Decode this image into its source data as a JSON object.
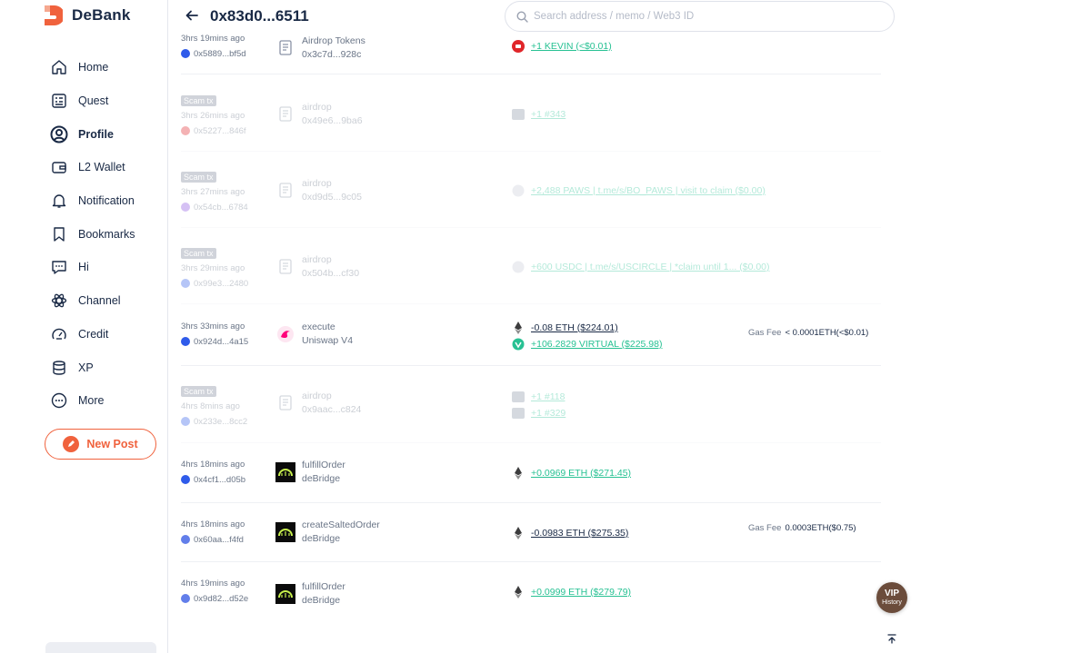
{
  "app": {
    "name": "DeBank"
  },
  "header": {
    "address": "0x83d0...6511",
    "search_placeholder": "Search address / memo / Web3 ID"
  },
  "sidebar": {
    "items": [
      {
        "label": "Home",
        "icon": "home-icon"
      },
      {
        "label": "Quest",
        "icon": "quest-icon"
      },
      {
        "label": "Profile",
        "icon": "profile-icon",
        "active": true
      },
      {
        "label": "L2 Wallet",
        "icon": "wallet-icon"
      },
      {
        "label": "Notification",
        "icon": "bell-icon"
      },
      {
        "label": "Bookmarks",
        "icon": "bookmark-icon"
      },
      {
        "label": "Hi",
        "icon": "chat-icon"
      },
      {
        "label": "Channel",
        "icon": "atom-icon"
      },
      {
        "label": "Credit",
        "icon": "gauge-icon"
      },
      {
        "label": "XP",
        "icon": "stack-icon"
      },
      {
        "label": "More",
        "icon": "more-icon"
      }
    ],
    "new_post": "New Post"
  },
  "history": [
    {
      "scam": false,
      "badge": "",
      "time": "3hrs 19mins ago",
      "hash": "0x5889...bf5d",
      "chain": "blue",
      "action": "Airdrop Tokens",
      "contract": "0x3c7d...928c",
      "icon": "contract-icon",
      "tokens": [
        {
          "value": "+1 KEVIN (<$0.01)",
          "dir": "pos",
          "icon": "kevin-token-icon"
        }
      ],
      "fee_label": "",
      "fee": ""
    },
    {
      "scam": true,
      "badge": "Scam tx",
      "time": "3hrs 26mins ago",
      "hash": "0x5227...846f",
      "chain": "red",
      "action": "airdrop",
      "contract": "0x49e6...9ba6",
      "icon": "contract-icon",
      "tokens": [
        {
          "value": "+1 #343",
          "dir": "pos",
          "icon": "nft-icon"
        }
      ],
      "fee_label": "",
      "fee": ""
    },
    {
      "scam": true,
      "badge": "Scam tx",
      "time": "3hrs 27mins ago",
      "hash": "0x54cb...6784",
      "chain": "purple",
      "action": "airdrop",
      "contract": "0xd9d5...9c05",
      "icon": "contract-icon",
      "tokens": [
        {
          "value": "+2,488 PAWS | t.me/s/BO_PAWS | visit to claim ($0.00)",
          "dir": "pos",
          "icon": "token-icon"
        }
      ],
      "fee_label": "",
      "fee": ""
    },
    {
      "scam": true,
      "badge": "Scam tx",
      "time": "3hrs 29mins ago",
      "hash": "0x99e3...2480",
      "chain": "blue",
      "action": "airdrop",
      "contract": "0x504b...cf30",
      "icon": "contract-icon",
      "tokens": [
        {
          "value": "+600 USDC | t.me/s/USCIRCLE | *claim until 1... ($0.00)",
          "dir": "pos",
          "icon": "token-icon"
        }
      ],
      "fee_label": "",
      "fee": ""
    },
    {
      "scam": false,
      "badge": "",
      "time": "3hrs 33mins ago",
      "hash": "0x924d...4a15",
      "chain": "blue",
      "action": "execute",
      "contract": "Uniswap V4",
      "icon": "uniswap-icon",
      "tokens": [
        {
          "value": "-0.08 ETH ($224.01)",
          "dir": "neg",
          "icon": "eth-icon"
        },
        {
          "value": "+106.2829 VIRTUAL ($225.98)",
          "dir": "pos",
          "icon": "virtual-token-icon"
        }
      ],
      "fee_label": "Gas Fee",
      "fee": "< 0.0001ETH(<$0.01)"
    },
    {
      "scam": true,
      "badge": "Scam tx",
      "time": "4hrs 8mins ago",
      "hash": "0x233e...8cc2",
      "chain": "blue",
      "action": "airdrop",
      "contract": "0x9aac...c824",
      "icon": "contract-icon",
      "tokens": [
        {
          "value": "+1 #118",
          "dir": "pos",
          "icon": "nft-icon"
        },
        {
          "value": "+1 #329",
          "dir": "pos",
          "icon": "nft-icon"
        }
      ],
      "fee_label": "",
      "fee": ""
    },
    {
      "scam": false,
      "badge": "",
      "time": "4hrs 18mins ago",
      "hash": "0x4cf1...d05b",
      "chain": "blue",
      "action": "fulfillOrder",
      "contract": "deBridge",
      "icon": "debridge-icon",
      "tokens": [
        {
          "value": "+0.0969 ETH ($271.45)",
          "dir": "pos",
          "icon": "eth-icon"
        }
      ],
      "fee_label": "",
      "fee": ""
    },
    {
      "scam": false,
      "badge": "",
      "time": "4hrs 18mins ago",
      "hash": "0x60aa...f4fd",
      "chain": "eth",
      "action": "createSaltedOrder",
      "contract": "deBridge",
      "icon": "debridge-icon",
      "tokens": [
        {
          "value": "-0.0983 ETH ($275.35)",
          "dir": "neg",
          "icon": "eth-icon"
        }
      ],
      "fee_label": "Gas Fee",
      "fee": "0.0003ETH($0.75)"
    },
    {
      "scam": false,
      "badge": "",
      "time": "4hrs 19mins ago",
      "hash": "0x9d82...d52e",
      "chain": "eth",
      "action": "fulfillOrder",
      "contract": "deBridge",
      "icon": "debridge-icon",
      "tokens": [
        {
          "value": "+0.0999 ETH ($279.79)",
          "dir": "pos",
          "icon": "eth-icon"
        }
      ],
      "fee_label": "",
      "fee": ""
    }
  ],
  "vip": {
    "label": "VIP",
    "sub": "History"
  },
  "colors": {
    "accent": "#f0623d",
    "positive": "#27c193",
    "text": "#192945",
    "muted": "#6a7587"
  }
}
